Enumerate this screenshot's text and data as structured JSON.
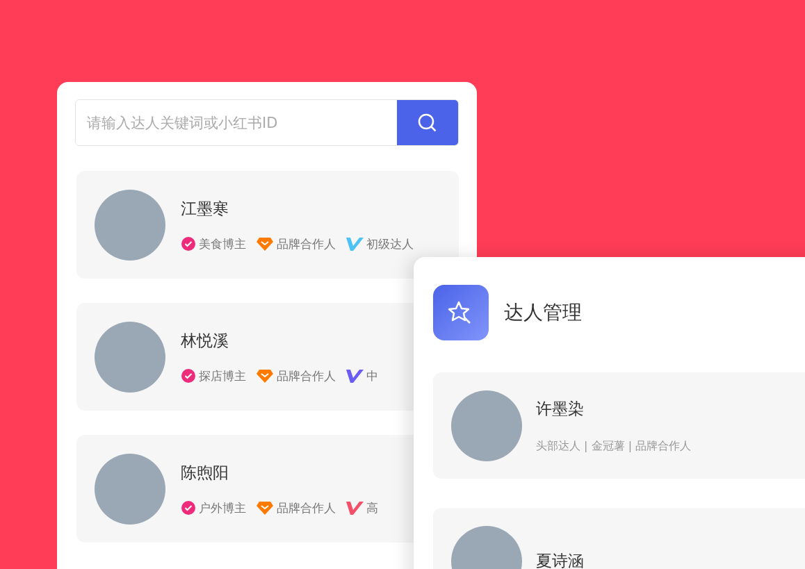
{
  "search_panel": {
    "search": {
      "placeholder": "请输入达人关键词或小红书ID"
    },
    "creators": [
      {
        "name": "江墨寒",
        "tags": [
          {
            "kind": "category",
            "label": "美食博主"
          },
          {
            "kind": "brand",
            "label": "品牌合作人"
          },
          {
            "kind": "level",
            "label": "初级达人",
            "color": "#4cc3f5"
          }
        ]
      },
      {
        "name": "林悦溪",
        "tags": [
          {
            "kind": "category",
            "label": "探店博主"
          },
          {
            "kind": "brand",
            "label": "品牌合作人"
          },
          {
            "kind": "level",
            "label": "中",
            "color": "#6a5cf5"
          }
        ]
      },
      {
        "name": "陈煦阳",
        "tags": [
          {
            "kind": "category",
            "label": "户外博主"
          },
          {
            "kind": "brand",
            "label": "品牌合作人"
          },
          {
            "kind": "level",
            "label": "高",
            "color": "#f5506a"
          }
        ]
      }
    ]
  },
  "manage_panel": {
    "title": "达人管理",
    "creators": [
      {
        "name": "许墨染",
        "subtitle": "头部达人 | 金冠薯 | 品牌合作人"
      },
      {
        "name": "夏诗涵"
      }
    ]
  }
}
